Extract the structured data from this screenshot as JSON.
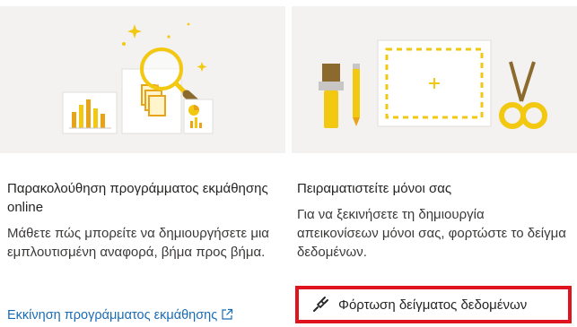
{
  "cards": [
    {
      "title": "Παρακολούθηση προγράμματος εκμάθησης online",
      "description": "Μάθετε πώς μπορείτε να δημιουργήσετε μια εμπλουτισμένη αναφορά, βήμα προς βήμα.",
      "link_label": "Εκκίνηση προγράμματος εκμάθησης",
      "icons": [
        "bar-chart-illustration",
        "documents-illustration",
        "magnifier-illustration",
        "external-link-icon"
      ]
    },
    {
      "title": "Πειραματιστείτε μόνοι σας",
      "description": "Για να ξεκινήσετε τη δημιουργία απεικονίσεων μόνοι σας, φορτώστε το δείγμα δεδομένων.",
      "button_label": "Φόρτωση δείγματος δεδομένων",
      "icons": [
        "paintbrush-illustration",
        "pencil-illustration",
        "canvas-placeholder-illustration",
        "scissors-illustration",
        "plug-icon"
      ]
    }
  ],
  "colors": {
    "accent_yellow": "#f2c811",
    "link_blue": "#1a6bb5",
    "highlight_red": "#e0141e",
    "illustration_bg": "#f3f2f1"
  }
}
